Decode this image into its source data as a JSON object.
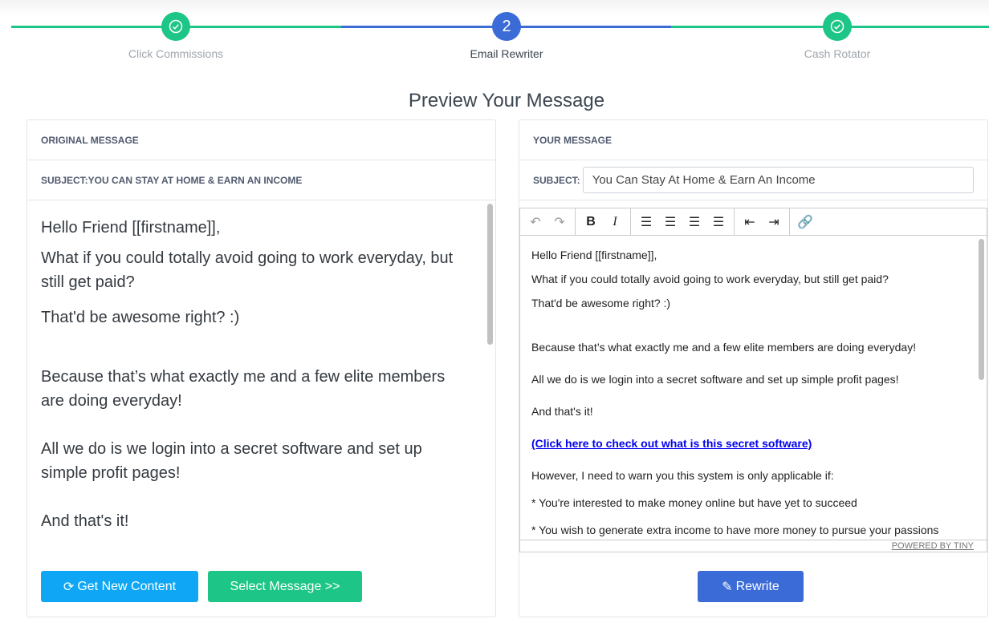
{
  "steps": [
    {
      "label": "Click Commissions",
      "state": "done",
      "icon": "check-icon"
    },
    {
      "label": "Email Rewriter",
      "state": "current",
      "number": "2"
    },
    {
      "label": "Cash Rotator",
      "state": "done",
      "icon": "check-icon"
    }
  ],
  "colors": {
    "done": "#1dc686",
    "current": "#3a6bd6",
    "get_new": "#0fa7f5",
    "select": "#1dc686",
    "rewrite": "#3a6bd6"
  },
  "title": "Preview Your Message",
  "original": {
    "header": "ORIGINAL MESSAGE",
    "subject": "SUBJECT:YOU CAN STAY AT HOME & EARN AN INCOME",
    "paragraphs": [
      "Hello Friend [[firstname]],",
      "What if you could totally avoid going to work everyday, but still get paid?",
      "That'd be awesome right? :)",
      "Because that’s what exactly me and a few elite members are doing everyday!",
      "All we do is we login into a secret software and set up simple profit pages!",
      "And that's it!"
    ],
    "get_new": "Get New Content",
    "select": "Select Message >>"
  },
  "yours": {
    "header": "YOUR MESSAGE",
    "subject_label": "SUBJECT:",
    "subject_value": "You Can Stay At Home & Earn An Income",
    "paragraphs": [
      "Hello Friend [[firstname]],",
      "What if you could totally avoid going to work everyday, but still get paid?",
      "That'd be awesome right? :)",
      "Because that’s what exactly me and a few elite members are doing everyday!",
      "All we do is we login into a secret software and set up simple profit pages!",
      "And that's it!",
      "(Click here to check out what is this secret software)",
      "However, I need to warn you this system is only applicable if:",
      "* You're interested to make money online but have yet to succeed",
      "* You wish to generate extra income to have more money to pursue your passions"
    ],
    "powered": "POWERED BY TINY",
    "rewrite": "Rewrite"
  }
}
